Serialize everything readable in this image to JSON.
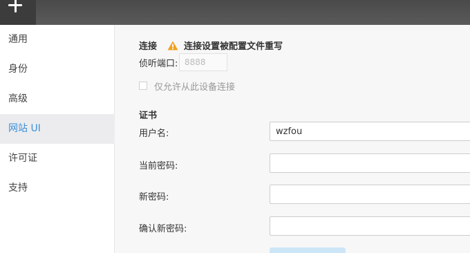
{
  "topbar": {
    "add_icon": "plus-icon"
  },
  "sidebar": {
    "items": [
      {
        "label": "通用",
        "active": false
      },
      {
        "label": "身份",
        "active": false
      },
      {
        "label": "高级",
        "active": false
      },
      {
        "label": "网站 UI",
        "active": true
      },
      {
        "label": "许可证",
        "active": false
      },
      {
        "label": "支持",
        "active": false
      }
    ]
  },
  "connection": {
    "title": "连接",
    "warning_icon": "warning-icon",
    "warning_text": "连接设置被配置文件重写",
    "port_label": "侦听端口:",
    "port_placeholder": "8888",
    "local_only_label": "仅允许从此设备连接",
    "local_only_checked": false
  },
  "certificate": {
    "title": "证书",
    "username_label": "用户名:",
    "username_value": "wzfou",
    "current_password_label": "当前密码:",
    "current_password_value": "",
    "new_password_label": "新密码:",
    "new_password_value": "",
    "confirm_password_label": "确认新密码:",
    "confirm_password_value": ""
  },
  "colors": {
    "accent": "#3b8fd7",
    "warning": "#f0a020",
    "topbar": "#555555"
  }
}
